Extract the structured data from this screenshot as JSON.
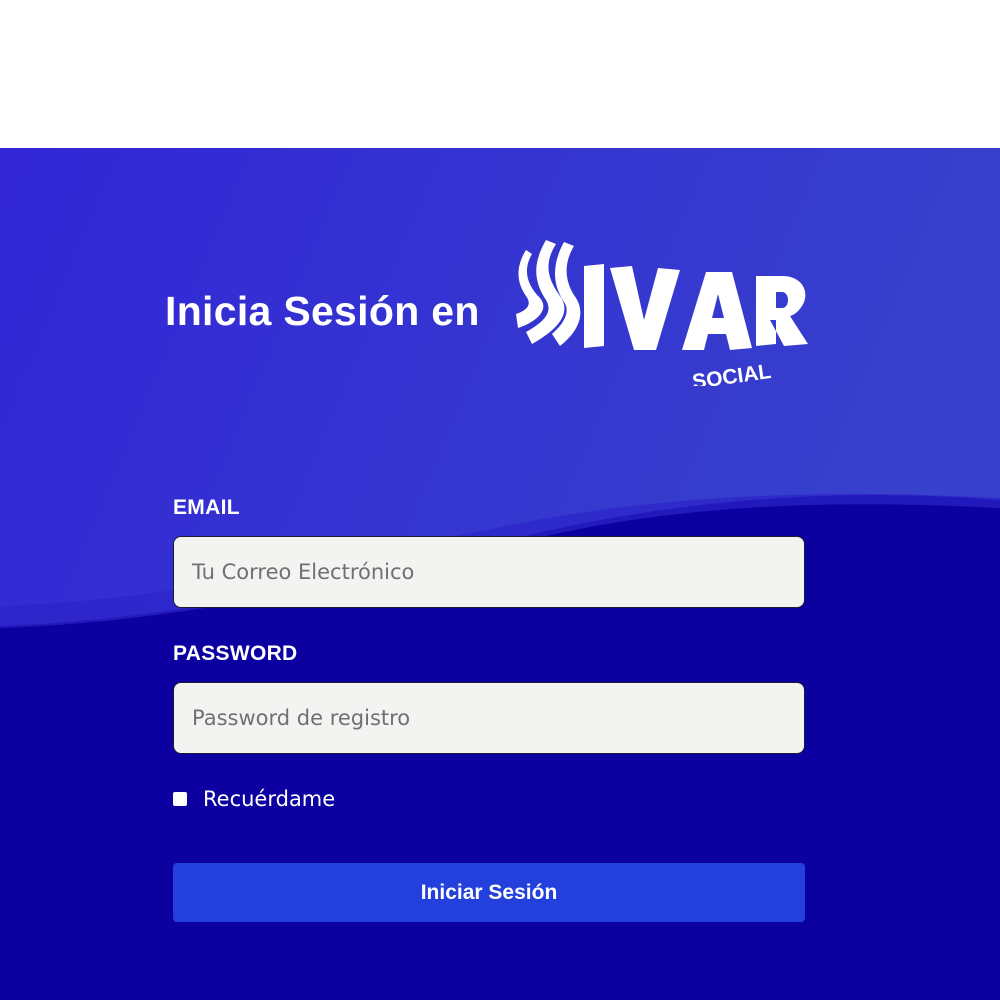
{
  "hero": {
    "title": "Inicia Sesión en",
    "brand_logo_name": "SIVAR",
    "brand_logo_subtitle": "SOCIAL"
  },
  "form": {
    "email_label": "EMAIL",
    "email_placeholder": "Tu Correo Electrónico",
    "email_value": "",
    "password_label": "PASSWORD",
    "password_placeholder": "Password de registro",
    "password_value": "",
    "remember_label": "Recuérdame",
    "remember_checked": false,
    "submit_label": "Iniciar Sesión"
  },
  "colors": {
    "hero_top": "#3a2fd8",
    "hero_bottom": "#0d00a0",
    "button": "#2440dc",
    "input_bg": "#f3f3f1"
  },
  "icons": {
    "brand_logo": "sivar-social-logo"
  }
}
